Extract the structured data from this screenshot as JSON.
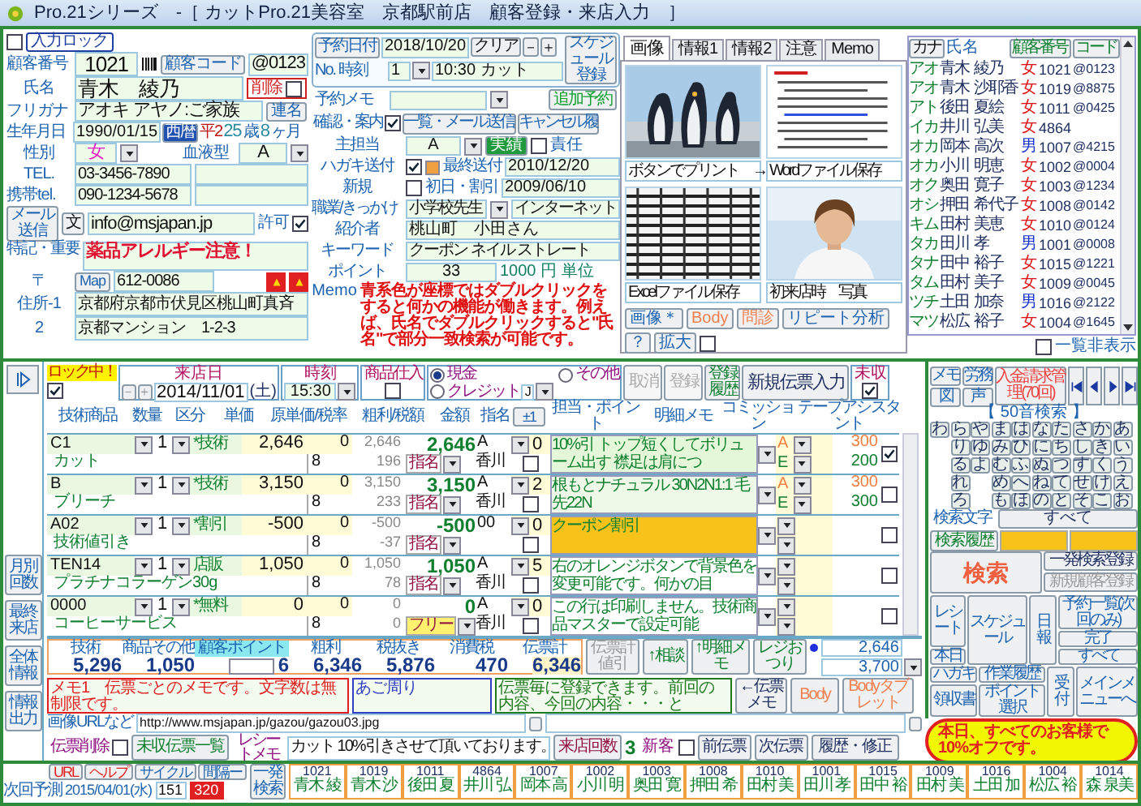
{
  "window": {
    "title": "Pro.21シリーズ　-［ カットPro.21美容室　京都駅前店　顧客登録・来店入力　］"
  },
  "customer": {
    "input_lock": {
      "label": "入力ロック",
      "checked": false
    },
    "number": {
      "label": "顧客番号",
      "value": "1021"
    },
    "code": {
      "label": "顧客コード",
      "value": "@0123"
    },
    "name": {
      "label": "氏名",
      "value": "青木　綾乃"
    },
    "delete": {
      "label": "削除",
      "checked": false
    },
    "furigana": {
      "label": "フリガナ",
      "value": "アオキ アヤノ:ご家族"
    },
    "joint_button": "連名",
    "birthday": {
      "label": "生年月日",
      "value": "1990/01/15",
      "era_button": "西暦",
      "era": "平2",
      "age": "25",
      "age_unit": "歳",
      "months": "8",
      "months_unit": "ヶ月"
    },
    "gender": {
      "label": "性別",
      "value": "女"
    },
    "blood_type": {
      "label": "血液型",
      "value": "A"
    },
    "tel": {
      "label": "TEL.",
      "value": "03-3456-7890"
    },
    "mobile": {
      "label": "携帯tel.",
      "value": "090-1234-5678"
    },
    "mail_buttons": [
      "メール送信",
      "文"
    ],
    "email": {
      "value": "info@msjapan.jp",
      "permit_label": "許可",
      "permitted": true
    },
    "note": {
      "label": "特記・重要",
      "value": "薬品アレルギー注意！"
    },
    "postal": {
      "label": "〒",
      "map_button": "Map",
      "value": "612-0086"
    },
    "address1": {
      "label": "住所-1",
      "value": "京都府京都市伏見区桃山町真斉"
    },
    "address2": {
      "label": "2",
      "value": "京都マンション　1-2-3"
    }
  },
  "reservation": {
    "date_button": "予約日付",
    "date": "2018/10/20",
    "buttons": [
      "クリア",
      "－",
      "＋"
    ],
    "schedule_button": "スケジュール登録",
    "no_label": "No. 時刻",
    "no": "1",
    "time": "10:30 カット",
    "memo_label": "予約メモ",
    "confirm_label": "確認・案内",
    "confirmed": true,
    "mail_button": "一覧・メール送信",
    "cancel_button": "キャンセル履",
    "add_button": "追加予約"
  },
  "profile": {
    "staff_label": "主担当",
    "staff": "A",
    "record_button": "実績",
    "responsible": {
      "label": "責任",
      "checked": false
    },
    "dm_label": "ハガキ送付",
    "dm_sent": true,
    "last_sent_label": "最終送付",
    "last_sent": "2010/12/20",
    "new_label": "新規",
    "is_new": false,
    "first_visit_label": "初日・割引",
    "first_visit": "2009/06/10",
    "job_label": "職業/きっかけ",
    "job": "小学校先生",
    "trigger": "インターネット",
    "referrer_label": "紹介者",
    "referrer": "桃山町　小田さん",
    "keyword_label": "キーワード",
    "keyword": "クーポン ネイル ストレート",
    "point_label": "ポイント",
    "point": "33",
    "point_unit": "1000 円 単位",
    "memo_label": "Memo",
    "memo": "青系色が座標ではダブルクリックをすると何かの機能が働きます。例えば、氏名でダブルクリックすると\"氏名\"で部分一致検索が可能です。"
  },
  "image_panel": {
    "tabs": [
      {
        "label": "画像",
        "selected": true
      },
      {
        "label": "情報1",
        "selected": false
      },
      {
        "label": "情報2",
        "selected": false
      },
      {
        "label": "注意",
        "selected": false
      },
      {
        "label": "Memo",
        "selected": false
      }
    ],
    "thumbnails": [
      {
        "caption": "ボタンでプリント　→"
      },
      {
        "kind": "document",
        "caption": "Wordファイル保存"
      },
      {
        "kind": "sheet",
        "caption": "Excelファイル保存"
      },
      {
        "kind": "portrait",
        "caption": "初来店時　写真"
      }
    ],
    "buttons": [
      "画像＊",
      "Body",
      "問診",
      "リピート分析",
      "？",
      "拡大"
    ],
    "enlarge_checked": false
  },
  "customer_list": {
    "kana_button": "カナ",
    "name_label": "氏名",
    "number_button": "顧客番号",
    "code_button": "コード",
    "rows": [
      {
        "kana": "アオ",
        "last": "青木",
        "first": "綾乃",
        "gender": "女",
        "color": "#e01010",
        "number": "1021",
        "code": "@0123"
      },
      {
        "kana": "アオ",
        "last": "青木",
        "first": "沙耶香",
        "gender": "女",
        "color": "#e01010",
        "number": "1019",
        "code": "@8875"
      },
      {
        "kana": "アト",
        "last": "後田",
        "first": "夏絵",
        "gender": "女",
        "color": "#e01010",
        "number": "1011",
        "code": "@0425"
      },
      {
        "kana": "イカ",
        "last": "井川",
        "first": "弘美",
        "gender": "女",
        "color": "#e01010",
        "number": "4864"
      },
      {
        "kana": "オカ",
        "last": "岡本",
        "first": "高次",
        "gender": "男",
        "color": "#1030d0",
        "number": "1007",
        "code": "@4215"
      },
      {
        "kana": "オカ",
        "last": "小川",
        "first": "明恵",
        "gender": "女",
        "color": "#e01010",
        "number": "1002",
        "code": "@0004"
      },
      {
        "kana": "オク",
        "last": "奥田",
        "first": "寛子",
        "gender": "女",
        "color": "#e01010",
        "number": "1003",
        "code": "@1234"
      },
      {
        "kana": "オシ",
        "last": "押田",
        "first": "希代子",
        "gender": "女",
        "color": "#e01010",
        "number": "1008",
        "code": "@0142"
      },
      {
        "kana": "キム",
        "last": "田村",
        "first": "美恵",
        "gender": "女",
        "color": "#e01010",
        "number": "1010",
        "code": "@0124"
      },
      {
        "kana": "タカ",
        "last": "田川",
        "first": "孝",
        "gender": "男",
        "color": "#1030d0",
        "number": "1001",
        "code": "@0008"
      },
      {
        "kana": "タナ",
        "last": "田中",
        "first": "裕子",
        "gender": "女",
        "color": "#e01010",
        "number": "1015",
        "code": "@1221"
      },
      {
        "kana": "タム",
        "last": "田村",
        "first": "美子",
        "gender": "女",
        "color": "#e01010",
        "number": "1009",
        "code": "@0045"
      },
      {
        "kana": "ツチ",
        "last": "土田",
        "first": "加奈",
        "gender": "男",
        "color": "#1030d0",
        "number": "1016",
        "code": "@2122"
      },
      {
        "kana": "マツ",
        "last": "松広",
        "first": "裕子",
        "gender": "女",
        "color": "#e01010",
        "number": "1004",
        "code": "@1645"
      }
    ],
    "hide": {
      "label": "一覧非表示",
      "checked": false
    }
  },
  "side_buttons": [
    "月別回数",
    "最終来店",
    "全体情報",
    "情報出力"
  ],
  "sales": {
    "lock": {
      "label": "ロック中！",
      "checked": true
    },
    "visit_date": {
      "label": "来店日",
      "buttons": [
        "－",
        "＋"
      ],
      "value": "2014/11/01",
      "weekday": "(土)"
    },
    "time": {
      "label": "時刻",
      "value": "15:30"
    },
    "goods": {
      "label": "商品仕入",
      "checked": false
    },
    "payment": {
      "options": [
        {
          "label": "現金",
          "selected": true
        },
        {
          "label": "その他",
          "selected": false
        },
        {
          "label": "クレジット",
          "selected": false
        }
      ],
      "card": "J"
    },
    "buttons": [
      {
        "label": "取消",
        "disabled": true
      },
      {
        "label": "登録",
        "disabled": true
      },
      {
        "label": "登録履歴",
        "disabled": false
      },
      {
        "label": "新規伝票入力",
        "disabled": false
      }
    ],
    "unpaid": {
      "label": "未収",
      "checked": true
    },
    "columns": [
      "技術商品",
      "数量",
      "区分",
      "単価",
      "原単価/税率",
      "粗利/税額",
      "金額",
      "指名",
      "±1",
      "担当・ポイント",
      "明細メモ",
      "コミッション",
      "テープアシスタント"
    ],
    "lines": [
      {
        "code": "C1",
        "qty": "1",
        "category": "*技術",
        "price": "2,646",
        "cost": "0",
        "profit": "2,646",
        "amount": "2,646",
        "nominee": "A",
        "name": "カット",
        "tax_rate": "8",
        "tax": "196",
        "designation": "指名",
        "stylist": "香川",
        "point": "0",
        "sub_checked": false,
        "memo": "10%引 トップ短くしてボリューム出す 襟足は肩につ",
        "color": "#e4f7d8",
        "commissions": [
          {
            "staff": "A",
            "value": "300"
          },
          {
            "staff": "E",
            "value": "200"
          }
        ],
        "checked": true
      },
      {
        "code": "B",
        "qty": "1",
        "category": "*技術",
        "price": "3,150",
        "cost": "0",
        "profit": "3,150",
        "amount": "3,150",
        "nominee": "A",
        "name": "ブリーチ",
        "tax_rate": "8",
        "tax": "233",
        "designation": "指名",
        "stylist": "香川",
        "point": "2",
        "sub_checked": false,
        "memo": "根もとナチュラル 30N2N1:1 毛先22N",
        "color": "#eef9e8",
        "commissions": [
          {
            "staff": "A",
            "value": "300"
          },
          {
            "staff": "E",
            "value": "300"
          }
        ],
        "checked": false
      },
      {
        "code": "A02",
        "qty": "1",
        "category": "*割引",
        "price": "-500",
        "cost": "0",
        "profit": "-500",
        "amount": "-500",
        "nominee": "00",
        "name": "技術値引き",
        "tax_rate": "8",
        "tax": "-37",
        "designation": "指名",
        "point": "0",
        "sub_checked": false,
        "memo": "クーポン割引",
        "color": "#f7c21a",
        "checked": false
      },
      {
        "code": "TEN14",
        "qty": "1",
        "category": "店販",
        "price": "1,050",
        "cost": "0",
        "profit": "1,050",
        "amount": "1,050",
        "nominee": "A",
        "name": "プラチナコラーゲン30g",
        "tax_rate": "8",
        "tax": "78",
        "designation": "指名",
        "stylist": "香川",
        "point": "5",
        "sub_checked": false,
        "memo": "右のオレンジボタンで背景色を変更可能です。何かの目",
        "color": "#ffffff",
        "checked": false
      },
      {
        "code": "0000",
        "qty": "1",
        "category": "*無料",
        "price": "0",
        "cost": "0",
        "profit": "0",
        "amount": "0",
        "nominee": "A",
        "name": "コーヒーサービス",
        "tax_rate": "8",
        "tax": "0",
        "designation": "フリー",
        "stylist": "香川",
        "point": "0",
        "sub_checked": false,
        "memo": "この行は印刷しません。技術商品マスターで設定可能",
        "color": "#ffffff",
        "checked": false
      }
    ],
    "totals": [
      {
        "kind": "amount",
        "label": "技術",
        "value": "5,296"
      },
      {
        "kind": "amount",
        "label": "商品その他",
        "value": "1,050"
      },
      {
        "kind": "point",
        "label": "顧客ポイント",
        "value": "6"
      },
      {
        "kind": "amount",
        "label": "粗利",
        "value": "6,346"
      },
      {
        "kind": "amount",
        "label": "税抜き",
        "value": "5,876"
      },
      {
        "kind": "amount",
        "label": "消費税",
        "value": "470"
      },
      {
        "kind": "total",
        "label": "伝票計",
        "value": "6,346"
      }
    ],
    "total_buttons": [
      "伝票計値引",
      "↑相談",
      "↑明細メモ",
      "レジおつり"
    ],
    "received": "2,646",
    "change": "3,700",
    "memos": [
      {
        "value": "メモ1　伝票ごとのメモです。文字数は無制限です。",
        "color": "#e02020"
      },
      {
        "value": "あご周り",
        "color": "#3040c0"
      },
      {
        "value": "伝票毎に登録できます。前回の内容、今回の内容・・・と",
        "color": "#207a20"
      }
    ],
    "memo_buttons": [
      "←伝票メモ",
      "Body",
      "Bodyタブレット"
    ],
    "url": {
      "label": "画像URLなど",
      "value": "http://www.msjapan.jp/gazou/gazou03.jpg"
    },
    "delete": {
      "label": "伝票削除",
      "checked": false
    },
    "unpaid_list_button": "未収伝票一覧",
    "receipt_memo": {
      "label": "レシートメモ",
      "value": "カット 10%引きさせて頂いております。"
    },
    "visits": {
      "button": "来店回数",
      "value": "3"
    },
    "new_customer": {
      "label": "新客",
      "checked": false
    },
    "nav_buttons": [
      "前伝票",
      "次伝票",
      "履歴・修正"
    ]
  },
  "right_panel": {
    "tool_buttons": [
      "メモ",
      "労務",
      "図",
      "声"
    ],
    "billing_button": "入金請求管理(70回)",
    "search_title": "【 50音検索 】",
    "kana_columns": [
      [
        "わ"
      ],
      [
        "ら",
        "り",
        "る",
        "れ",
        "ろ"
      ],
      [
        "や",
        "ゆ",
        "よ"
      ],
      [
        "ま",
        "み",
        "む",
        "め",
        "も"
      ],
      [
        "は",
        "ひ",
        "ふ",
        "へ",
        "ほ"
      ],
      [
        "な",
        "に",
        "ぬ",
        "ね",
        "の"
      ],
      [
        "た",
        "ち",
        "つ",
        "て",
        "と"
      ],
      [
        "さ",
        "し",
        "す",
        "せ",
        "そ"
      ],
      [
        "か",
        "き",
        "く",
        "け",
        "こ"
      ],
      [
        "あ",
        "い",
        "う",
        "え",
        "お"
      ]
    ],
    "all_button": "すべて",
    "search_text_label": "検索文字",
    "history_button": "検索履歴",
    "search_button": "検索",
    "quick_register_button": "一発検索登録",
    "new_customer_button": "新規顧客登録",
    "menu_buttons": [
      "レシート",
      "本日",
      "スケジュール",
      "日報",
      "予約一覧(次回のみ)",
      "完了",
      "すべて",
      "ハガキ",
      "作業履歴",
      "領収書",
      "ポイント選択",
      "受付",
      "メインメニューへ"
    ],
    "announcement": "本日、すべてのお客様で10%オフです。"
  },
  "bottom": {
    "buttons": [
      "URL",
      "ヘルプ",
      "サイクル",
      "間隔ー"
    ],
    "forecast_label": "次回予測",
    "forecast": "2015/04/01(水)",
    "cycle": "151",
    "interval": "320",
    "quick_search_button": "一発検索",
    "recent": [
      {
        "number": "1021",
        "name": "青木 綾"
      },
      {
        "number": "1019",
        "name": "青木 沙"
      },
      {
        "number": "1011",
        "name": "後田 夏"
      },
      {
        "number": "4864",
        "name": "井川 弘"
      },
      {
        "number": "1007",
        "name": "岡本 高"
      },
      {
        "number": "1002",
        "name": "小川 明"
      },
      {
        "number": "1003",
        "name": "奥田 寛"
      },
      {
        "number": "1008",
        "name": "押田 希"
      },
      {
        "number": "1010",
        "name": "田村 美"
      },
      {
        "number": "1001",
        "name": "田川 孝"
      },
      {
        "number": "1015",
        "name": "田中 裕"
      },
      {
        "number": "1009",
        "name": "田村 美"
      },
      {
        "number": "1016",
        "name": "土田 加"
      },
      {
        "number": "1004",
        "name": "松広 裕"
      },
      {
        "number": "1014",
        "name": "森 泉美"
      }
    ]
  }
}
